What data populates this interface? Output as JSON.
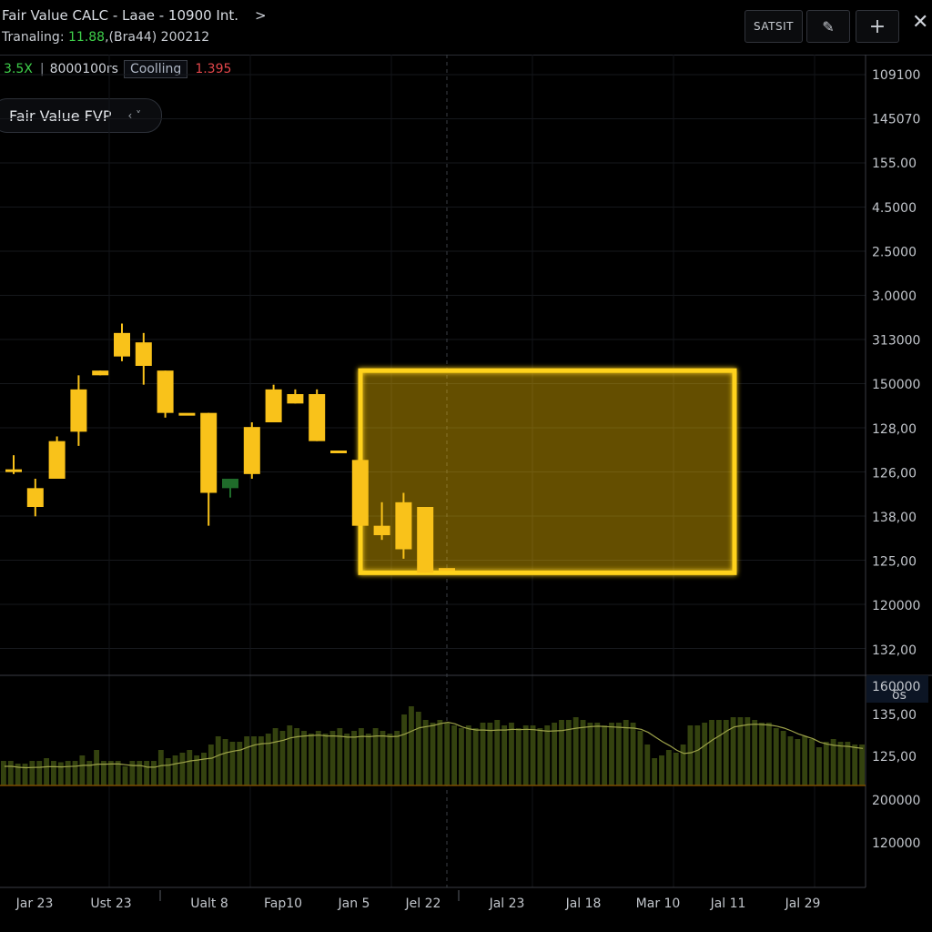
{
  "header": {
    "title": "Fair Value CALC - Laae - 10900 Int.",
    "chevron": ">",
    "subtitle_prefix": "Tranaling: ",
    "subtitle_value": "11.88",
    "subtitle_suffix": ",(Bra44) 200212",
    "buttons": {
      "sat": "SATSIT",
      "pen": "✎",
      "plus": "+",
      "close": "✕"
    }
  },
  "infobar": {
    "mult": "3.5X",
    "range": "8000100rs",
    "status": "Coolling",
    "change": "1.395"
  },
  "indicator": {
    "label": "Fair Value FVP",
    "arrows": "‹ ˅"
  },
  "colors": {
    "candle": "#f9c21a",
    "fvp": "#ffd21a",
    "bear": "#1f6b2a",
    "volume": "#34420f",
    "ma": "#9da24a",
    "baseline": "#7a4a00"
  },
  "chart_data": {
    "type": "candlestick",
    "price_axis_labels": [
      "109100",
      "145070",
      "155.00",
      "4.5000",
      "2.5000",
      "3.0000",
      "313000",
      "150000",
      "128,00",
      "126,00",
      "138,00",
      "125,00",
      "120000",
      "132,00"
    ],
    "volume_axis_labels": [
      "160000",
      "135,00",
      "125,00",
      "200000",
      "120000"
    ],
    "volume_axis_badge": "δs",
    "x_labels": [
      "Jar 23",
      "Ust 23",
      "Ualt 8",
      "Fap10",
      "Jan 5",
      "Jel 22",
      "Jal 23",
      "Jal 18",
      "Mar 10",
      "Jal 11",
      "Jal 29"
    ],
    "candles": [
      {
        "o": 126.6,
        "h": 126.9,
        "l": 126.5,
        "c": 126.6
      },
      {
        "o": 126.2,
        "h": 126.4,
        "l": 125.6,
        "c": 125.8
      },
      {
        "o": 126.4,
        "h": 127.3,
        "l": 126.4,
        "c": 127.2
      },
      {
        "o": 127.4,
        "h": 128.6,
        "l": 127.1,
        "c": 128.3
      },
      {
        "o": 128.6,
        "h": 128.7,
        "l": 128.6,
        "c": 128.7
      },
      {
        "o": 129.0,
        "h": 129.7,
        "l": 128.9,
        "c": 129.5
      },
      {
        "o": 129.3,
        "h": 129.5,
        "l": 128.4,
        "c": 128.8
      },
      {
        "o": 128.7,
        "h": 128.7,
        "l": 127.7,
        "c": 127.8
      },
      {
        "o": 127.8,
        "h": 127.8,
        "l": 127.8,
        "c": 127.8
      },
      {
        "o": 127.8,
        "h": 127.8,
        "l": 125.4,
        "c": 126.1
      },
      {
        "o": 126.2,
        "h": 126.4,
        "l": 126.0,
        "c": 126.4
      },
      {
        "o": 126.5,
        "h": 127.6,
        "l": 126.4,
        "c": 127.5
      },
      {
        "o": 127.6,
        "h": 128.4,
        "l": 127.6,
        "c": 128.3
      },
      {
        "o": 128.0,
        "h": 128.3,
        "l": 128.0,
        "c": 128.2
      },
      {
        "o": 128.2,
        "h": 128.3,
        "l": 127.2,
        "c": 127.2
      },
      {
        "o": 127.0,
        "h": 127.0,
        "l": 127.0,
        "c": 127.0
      },
      {
        "o": 126.8,
        "h": 126.8,
        "l": 125.4,
        "c": 125.4
      },
      {
        "o": 125.4,
        "h": 125.9,
        "l": 125.1,
        "c": 125.2
      },
      {
        "o": 125.9,
        "h": 126.1,
        "l": 124.7,
        "c": 124.9
      },
      {
        "o": 125.8,
        "h": 125.8,
        "l": 124.4,
        "c": 124.4
      },
      {
        "o": 124.5,
        "h": 124.5,
        "l": 124.5,
        "c": 124.5
      }
    ],
    "fvp_zone": {
      "top": 128.7,
      "bottom": 124.4
    },
    "volume": [
      18,
      18,
      16,
      16,
      18,
      18,
      20,
      18,
      17,
      18,
      18,
      22,
      18,
      26,
      18,
      18,
      18,
      14,
      18,
      18,
      18,
      18,
      26,
      20,
      22,
      24,
      26,
      22,
      24,
      30,
      36,
      34,
      32,
      32,
      36,
      36,
      36,
      38,
      42,
      40,
      44,
      42,
      40,
      38,
      40,
      38,
      40,
      42,
      38,
      40,
      42,
      38,
      42,
      40,
      38,
      40,
      52,
      58,
      54,
      48,
      46,
      48,
      46,
      44,
      42,
      44,
      42,
      46,
      46,
      48,
      44,
      46,
      42,
      44,
      44,
      42,
      44,
      46,
      48,
      48,
      50,
      48,
      46,
      46,
      44,
      46,
      46,
      48,
      46,
      40,
      30,
      20,
      22,
      26,
      24,
      30,
      44,
      44,
      46,
      48,
      48,
      48,
      50,
      50,
      50,
      48,
      46,
      46,
      42,
      40,
      36,
      34,
      36,
      34,
      28,
      32,
      34,
      32,
      32,
      30,
      30
    ]
  }
}
